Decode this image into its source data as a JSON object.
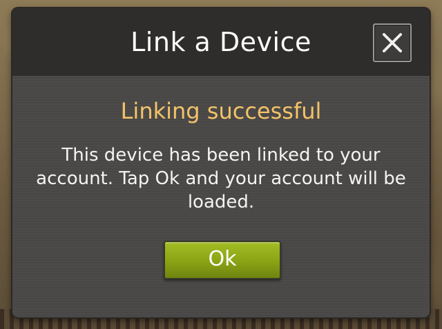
{
  "dialog": {
    "title": "Link a Device",
    "close_icon": "close-icon",
    "heading": "Linking successful",
    "message": "This device has been linked to your account. Tap Ok and your account will be loaded.",
    "ok_label": "Ok"
  },
  "colors": {
    "heading": "#f3c36a",
    "ok_button": "#8aa314",
    "dialog_bg": "#4a4846",
    "header_bg": "#2f2d2b"
  }
}
